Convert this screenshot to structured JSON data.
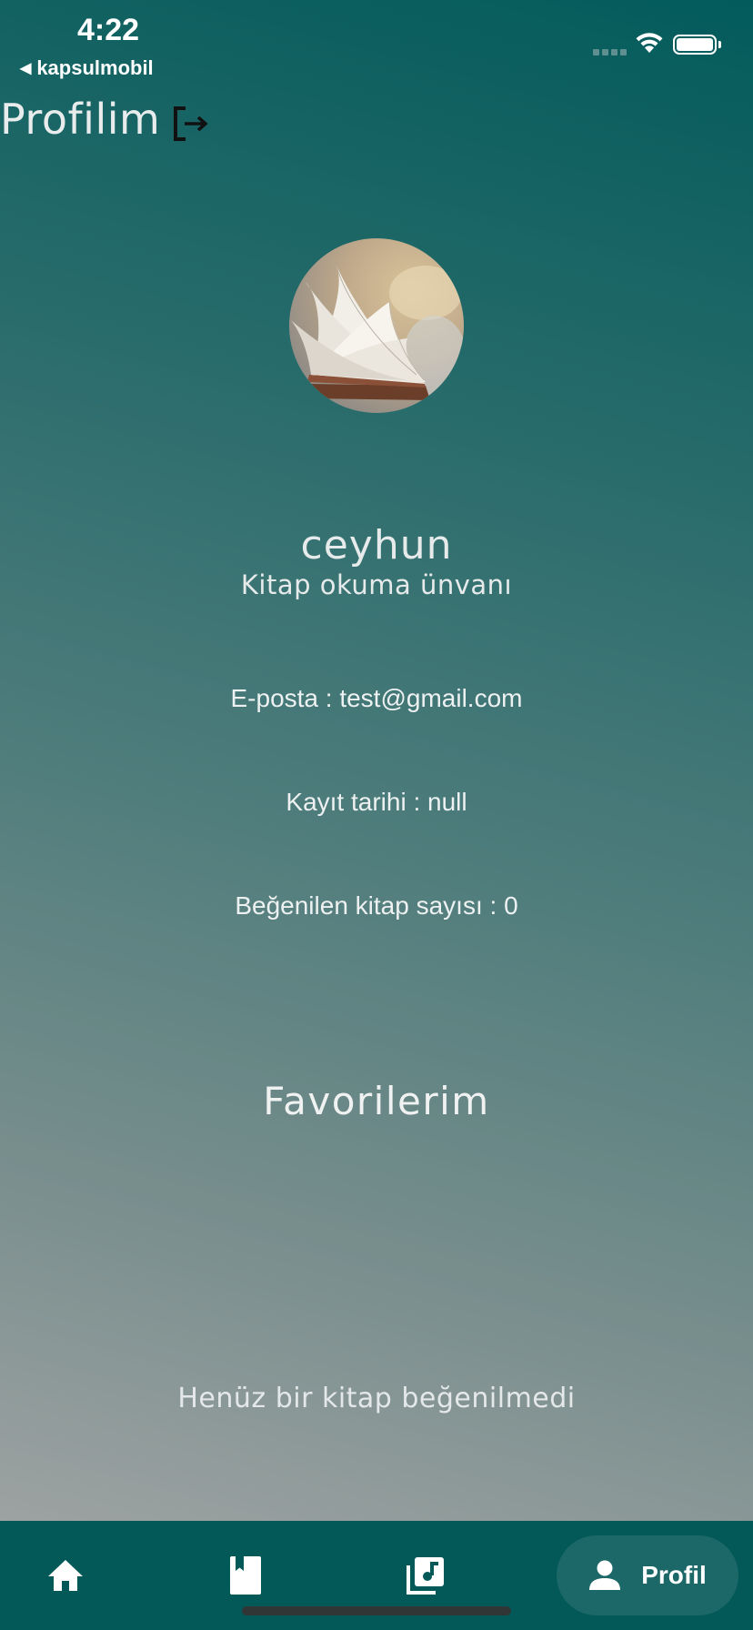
{
  "status_bar": {
    "time": "4:22",
    "back_app": "kapsulmobil"
  },
  "header": {
    "title": "Profilim"
  },
  "profile": {
    "username": "ceyhun",
    "subtitle": "Kitap okuma ünvanı",
    "email_line": "E-posta : test@gmail.com",
    "registration_line": "Kayıt tarihi : null",
    "liked_count_line": "Beğenilen kitap sayısı : 0"
  },
  "favorites": {
    "title": "Favorilerim",
    "empty_message": "Henüz bir kitap beğenilmedi"
  },
  "bottom_nav": {
    "active_label": "Profil",
    "items": [
      {
        "icon": "home-icon"
      },
      {
        "icon": "book-bookmark-icon"
      },
      {
        "icon": "audiobook-library-icon"
      },
      {
        "icon": "person-icon"
      }
    ]
  },
  "colors": {
    "nav_background": "#035858",
    "active_pill": "#1c6868",
    "gradient_top": "#035b5b",
    "gradient_bottom": "#9da2a2"
  }
}
